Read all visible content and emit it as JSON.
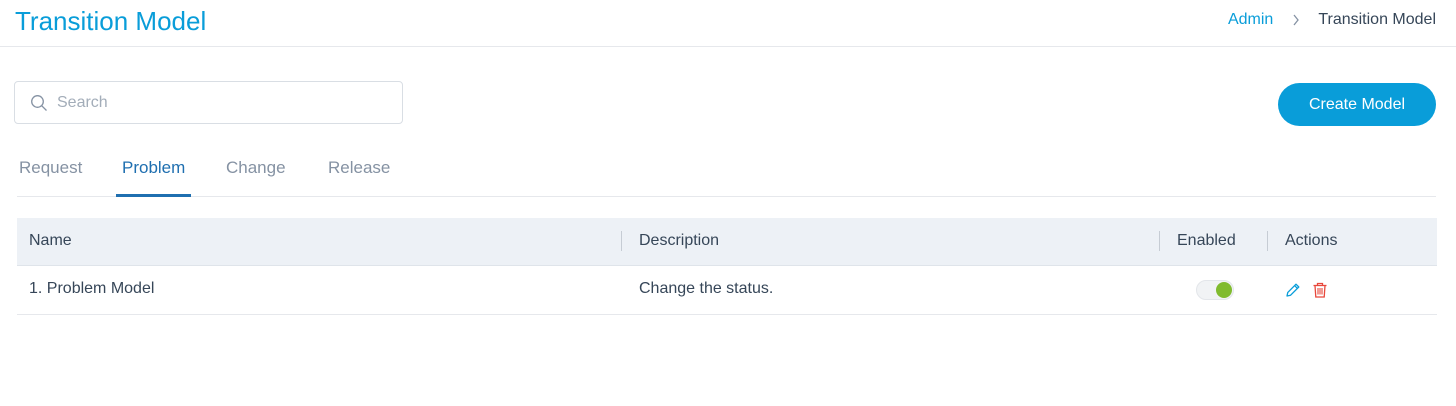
{
  "header": {
    "title": "Transition Model",
    "breadcrumb": {
      "link": "Admin",
      "current": "Transition Model"
    }
  },
  "search": {
    "placeholder": "Search",
    "value": ""
  },
  "toolbar": {
    "create_label": "Create Model"
  },
  "tabs": [
    {
      "label": "Request",
      "active": false
    },
    {
      "label": "Problem",
      "active": true
    },
    {
      "label": "Change",
      "active": false
    },
    {
      "label": "Release",
      "active": false
    }
  ],
  "table": {
    "columns": [
      "Name",
      "Description",
      "Enabled",
      "Actions"
    ],
    "rows": [
      {
        "name": "1. Problem Model",
        "description": "Change the status.",
        "enabled": true
      }
    ]
  },
  "colors": {
    "accent": "#099dd9",
    "tab_active": "#1f6fb0",
    "toggle_on": "#80bb2e",
    "delete": "#e8473b"
  },
  "icons": [
    "search-icon",
    "chevron-right-icon",
    "pencil-icon",
    "trash-icon"
  ]
}
